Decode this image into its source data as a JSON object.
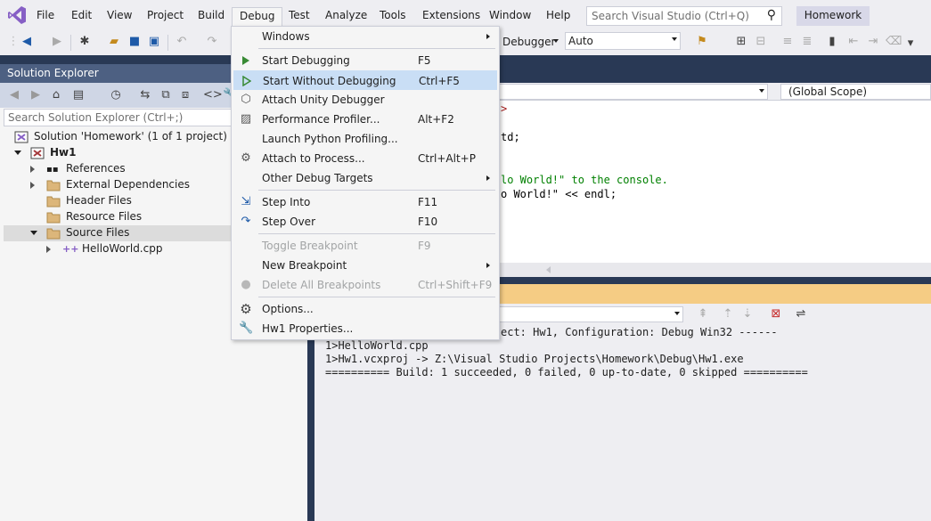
{
  "menubar": {
    "items": [
      "File",
      "Edit",
      "View",
      "Project",
      "Build",
      "Debug",
      "Test",
      "Analyze",
      "Tools",
      "Extensions",
      "Window",
      "Help"
    ],
    "search_placeholder": "Search Visual Studio (Ctrl+Q)",
    "solution_name": "Homework"
  },
  "toolbar": {
    "debugger_label": "Debugger",
    "config_value": "Auto"
  },
  "solution_explorer": {
    "title": "Solution Explorer",
    "search_placeholder": "Search Solution Explorer (Ctrl+;)",
    "tree": [
      {
        "label": "Solution 'Homework' (1 of 1 project)",
        "icon": "solution-icon"
      },
      {
        "label": "Hw1",
        "icon": "project-icon"
      },
      {
        "label": "References",
        "icon": "references-icon"
      },
      {
        "label": "External Dependencies",
        "icon": "folder-icon"
      },
      {
        "label": "Header Files",
        "icon": "folder-icon"
      },
      {
        "label": "Resource Files",
        "icon": "folder-icon"
      },
      {
        "label": "Source Files",
        "icon": "folder-icon"
      },
      {
        "label": "HelloWorld.cpp",
        "icon": "cpp-file-icon"
      }
    ]
  },
  "editor": {
    "scope_label": "(Global Scope)",
    "code_lines": [
      {
        "text": ">",
        "color": "#a31515"
      },
      {
        "text": "td;",
        "color": "#000000"
      },
      {
        "text": "lo World!\" to the console.",
        "color": "#008000"
      },
      {
        "text": "o World!\" << endl;",
        "color": "#000000"
      }
    ]
  },
  "output": {
    "lines": [
      "ect: Hw1, Configuration: Debug Win32 ------",
      "1>HelloWorld.cpp",
      "1>Hw1.vcxproj -> Z:\\Visual Studio Projects\\Homework\\Debug\\Hw1.exe",
      "========== Build: 1 succeeded, 0 failed, 0 up-to-date, 0 skipped =========="
    ]
  },
  "debug_menu": {
    "items": [
      {
        "label": "Windows",
        "shortcut": "",
        "submenu": true,
        "icon": "",
        "disabled": false
      },
      {
        "label": "Start Debugging",
        "shortcut": "F5",
        "submenu": false,
        "icon": "play-icon",
        "disabled": false
      },
      {
        "label": "Start Without Debugging",
        "shortcut": "Ctrl+F5",
        "submenu": false,
        "icon": "play-outline-icon",
        "disabled": false,
        "highlighted": true
      },
      {
        "label": "Attach Unity Debugger",
        "shortcut": "",
        "submenu": false,
        "icon": "unity-icon",
        "disabled": false
      },
      {
        "label": "Performance Profiler...",
        "shortcut": "Alt+F2",
        "submenu": false,
        "icon": "profiler-icon",
        "disabled": false
      },
      {
        "label": "Launch Python Profiling...",
        "shortcut": "",
        "submenu": false,
        "icon": "",
        "disabled": false
      },
      {
        "label": "Attach to Process...",
        "shortcut": "Ctrl+Alt+P",
        "submenu": false,
        "icon": "attach-process-icon",
        "disabled": false
      },
      {
        "label": "Other Debug Targets",
        "shortcut": "",
        "submenu": true,
        "icon": "",
        "disabled": false
      },
      {
        "label": "Step Into",
        "shortcut": "F11",
        "submenu": false,
        "icon": "step-into-icon",
        "disabled": false
      },
      {
        "label": "Step Over",
        "shortcut": "F10",
        "submenu": false,
        "icon": "step-over-icon",
        "disabled": false
      },
      {
        "label": "Toggle Breakpoint",
        "shortcut": "F9",
        "submenu": false,
        "icon": "",
        "disabled": true
      },
      {
        "label": "New Breakpoint",
        "shortcut": "",
        "submenu": true,
        "icon": "",
        "disabled": false
      },
      {
        "label": "Delete All Breakpoints",
        "shortcut": "Ctrl+Shift+F9",
        "submenu": false,
        "icon": "delete-breakpoints-icon",
        "disabled": true
      },
      {
        "label": "Options...",
        "shortcut": "",
        "submenu": false,
        "icon": "gear-icon",
        "disabled": false
      },
      {
        "label": "Hw1 Properties...",
        "shortcut": "",
        "submenu": false,
        "icon": "wrench-icon",
        "disabled": false
      }
    ]
  },
  "colors": {
    "frame": "#293955",
    "panel_title": "#4d6082",
    "output_title": "#f5cc84",
    "menu_highlight": "#c9def5",
    "vs_purple": "#865fc5"
  }
}
